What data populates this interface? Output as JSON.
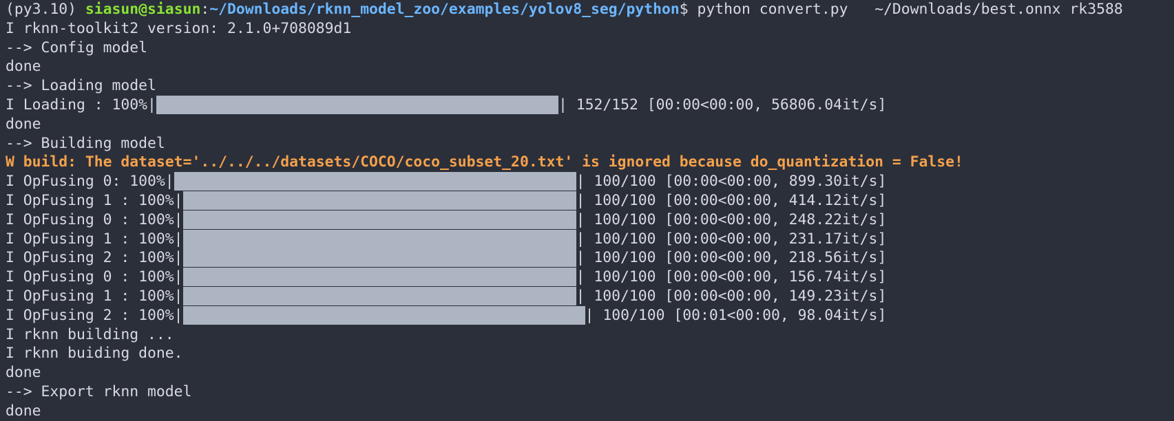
{
  "prompt": {
    "venv": "(py3.10) ",
    "user_host": "siasun@siasun",
    "colon": ":",
    "path": "~/Downloads/rknn_model_zoo/examples/yolov8_seg/python",
    "symbol": "$ ",
    "command": "python convert.py   ~/Downloads/best.onnx rk3588"
  },
  "lines": {
    "toolkit": "I rknn-toolkit2 version: 2.1.0+708089d1",
    "config": "--> Config model",
    "done1": "done",
    "loading_header": "--> Loading model",
    "done2": "done",
    "building_header": "--> Building model",
    "warning": "W build: The dataset='../../../datasets/COCO/coco_subset_20.txt' is ignored because do_quantization = False!",
    "rknn_building": "I rknn building ...",
    "rknn_done": "I rknn buiding done.",
    "done3": "done",
    "export": "--> Export rknn model",
    "done4": "done"
  },
  "progress": {
    "loading": {
      "prefix": "I Loading : 100%|",
      "suffix": "| 152/152 [00:00<00:00, 56806.04it/s]",
      "percent": 100
    },
    "opfusing": [
      {
        "prefix": "I OpFusing 0: 100%|",
        "suffix": "| 100/100 [00:00<00:00, 899.30it/s]",
        "percent": 100
      },
      {
        "prefix": "I OpFusing 1 : 100%|",
        "suffix": "| 100/100 [00:00<00:00, 414.12it/s]",
        "percent": 100
      },
      {
        "prefix": "I OpFusing 0 : 100%|",
        "suffix": "| 100/100 [00:00<00:00, 248.22it/s]",
        "percent": 100
      },
      {
        "prefix": "I OpFusing 1 : 100%|",
        "suffix": "| 100/100 [00:00<00:00, 231.17it/s]",
        "percent": 100
      },
      {
        "prefix": "I OpFusing 2 : 100%|",
        "suffix": "| 100/100 [00:00<00:00, 218.56it/s]",
        "percent": 100
      },
      {
        "prefix": "I OpFusing 0 : 100%|",
        "suffix": "| 100/100 [00:00<00:00, 156.74it/s]",
        "percent": 100
      },
      {
        "prefix": "I OpFusing 1 : 100%|",
        "suffix": "| 100/100 [00:00<00:00, 149.23it/s]",
        "percent": 100
      },
      {
        "prefix": "I OpFusing 2 : 100%|",
        "suffix": "| 100/100 [00:01<00:00, 98.04it/s]",
        "percent": 100
      }
    ]
  },
  "colors": {
    "background": "#2b2f3a",
    "text": "#d7dae0",
    "user": "#8ae234",
    "path": "#6cb6ff",
    "warning": "#f5a14b",
    "bar": "#adb4c2"
  }
}
